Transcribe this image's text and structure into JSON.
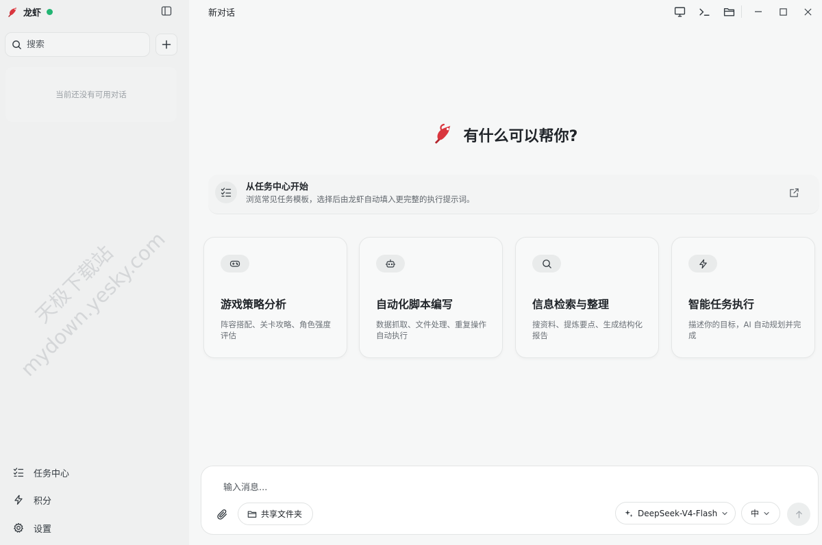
{
  "sidebar": {
    "brand_name": "龙虾",
    "search_placeholder": "搜索",
    "empty_text": "当前还没有可用对话",
    "nav": [
      {
        "label": "任务中心",
        "icon": "checklist-icon"
      },
      {
        "label": "积分",
        "icon": "lightning-icon"
      },
      {
        "label": "设置",
        "icon": "gear-icon"
      }
    ]
  },
  "header": {
    "title": "新对话",
    "icons": [
      "monitor-icon",
      "terminal-icon",
      "folder-icon",
      "minimize-icon",
      "maximize-icon",
      "close-icon"
    ]
  },
  "hero": {
    "title": "有什么可以帮你?"
  },
  "task_banner": {
    "title": "从任务中心开始",
    "desc": "浏览常见任务模板，选择后由龙虾自动填入更完整的执行提示词。"
  },
  "cards": [
    {
      "title": "游戏策略分析",
      "desc": "阵容搭配、关卡攻略、角色强度评估",
      "icon": "gamepad-icon"
    },
    {
      "title": "自动化脚本编写",
      "desc": "数据抓取、文件处理、重复操作自动执行",
      "icon": "robot-icon"
    },
    {
      "title": "信息检索与整理",
      "desc": "搜资料、提炼要点、生成结构化报告",
      "icon": "search-icon"
    },
    {
      "title": "智能任务执行",
      "desc": "描述你的目标，AI 自动规划并完成",
      "icon": "lightning-icon"
    }
  ],
  "composer": {
    "placeholder": "输入消息...",
    "shared_folder_label": "共享文件夹",
    "model_label": "DeepSeek-V4-Flash",
    "lang_label": "中"
  },
  "watermark": {
    "line1": "天极下载站",
    "line2": "mydown.yesky.com"
  },
  "colors": {
    "status_dot": "#22b573",
    "sidebar_bg": "#eff0f0",
    "main_bg": "#f6f7f7",
    "logo_red": "#d9363e"
  }
}
